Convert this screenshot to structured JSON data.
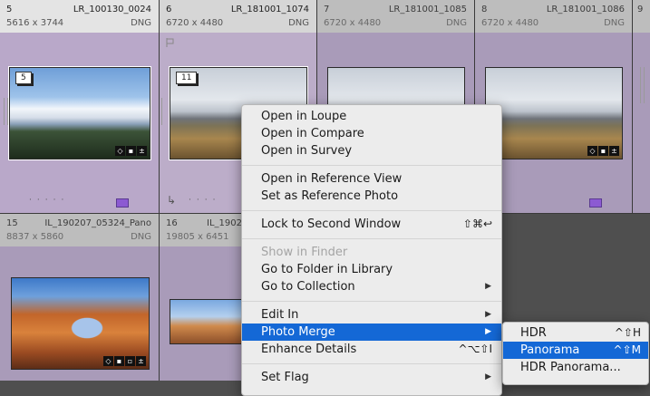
{
  "cells": [
    {
      "num": "5",
      "fname": "LR_100130_0024",
      "dims": "5616 x 3744",
      "ftype": "DNG",
      "badge": "5"
    },
    {
      "num": "6",
      "fname": "LR_181001_1074",
      "dims": "6720 x 4480",
      "ftype": "DNG",
      "badge": "11"
    },
    {
      "num": "7",
      "fname": "LR_181001_1085",
      "dims": "6720 x 4480",
      "ftype": "DNG"
    },
    {
      "num": "8",
      "fname": "LR_181001_1086",
      "dims": "6720 x 4480",
      "ftype": "DNG"
    },
    {
      "num": "9"
    },
    {
      "num": "15",
      "fname": "IL_190207_05324_Pano",
      "dims": "8837 x 5860",
      "ftype": "DNG"
    },
    {
      "num": "16",
      "fname": "IL_1902",
      "dims": "19805 x 6451"
    }
  ],
  "menu": {
    "items": [
      {
        "label": "Open in Loupe"
      },
      {
        "label": "Open in Compare"
      },
      {
        "label": "Open in Survey"
      },
      {
        "label": "Open in Reference View"
      },
      {
        "label": "Set as Reference Photo"
      },
      {
        "label": "Lock to Second Window",
        "shortcut": "⇧⌘↩"
      },
      {
        "label": "Show in Finder"
      },
      {
        "label": "Go to Folder in Library"
      },
      {
        "label": "Go to Collection",
        "arrow": "▶"
      },
      {
        "label": "Edit In",
        "arrow": "▶"
      },
      {
        "label": "Photo Merge",
        "arrow": "▶"
      },
      {
        "label": "Enhance Details",
        "shortcut": "^⌥⇧I"
      },
      {
        "label": "Set Flag",
        "arrow": "▶"
      }
    ]
  },
  "submenu": {
    "items": [
      {
        "label": "HDR",
        "shortcut": "^⇧H"
      },
      {
        "label": "Panorama",
        "shortcut": "^⇧M"
      },
      {
        "label": "HDR Panorama..."
      }
    ]
  },
  "colors": {
    "highlight": "#1468d6",
    "color_label": "#8c5ad2"
  }
}
